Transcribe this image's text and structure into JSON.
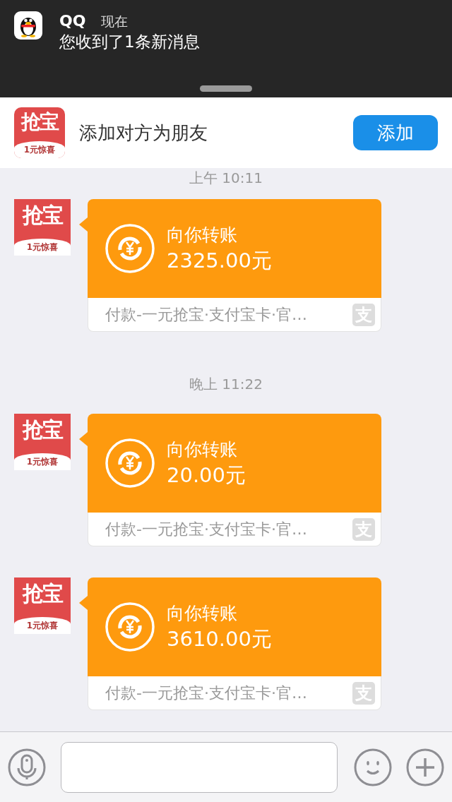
{
  "notification": {
    "app": "QQ",
    "time": "现在",
    "message": "您收到了1条新消息"
  },
  "banner": {
    "avatar": {
      "title": "抢宝",
      "caption": "1元惊喜"
    },
    "text": "添加对方为朋友",
    "button": "添加"
  },
  "messages": [
    {
      "kind": "time",
      "text": "上午 10:11"
    },
    {
      "kind": "transfer",
      "avatar": {
        "title": "抢宝",
        "caption": "1元惊喜"
      },
      "title": "向你转账",
      "amount": "2325.00元",
      "note": "付款-一元抢宝·支付宝卡·官…",
      "badge": "支"
    },
    {
      "kind": "time",
      "text": "晚上 11:22"
    },
    {
      "kind": "transfer",
      "avatar": {
        "title": "抢宝",
        "caption": "1元惊喜"
      },
      "title": "向你转账",
      "amount": "20.00元",
      "note": "付款-一元抢宝·支付宝卡·官…",
      "badge": "支"
    },
    {
      "kind": "transfer",
      "avatar": {
        "title": "抢宝",
        "caption": "1元惊喜"
      },
      "title": "向你转账",
      "amount": "3610.00元",
      "note": "付款-一元抢宝·支付宝卡·官…",
      "badge": "支"
    }
  ]
}
